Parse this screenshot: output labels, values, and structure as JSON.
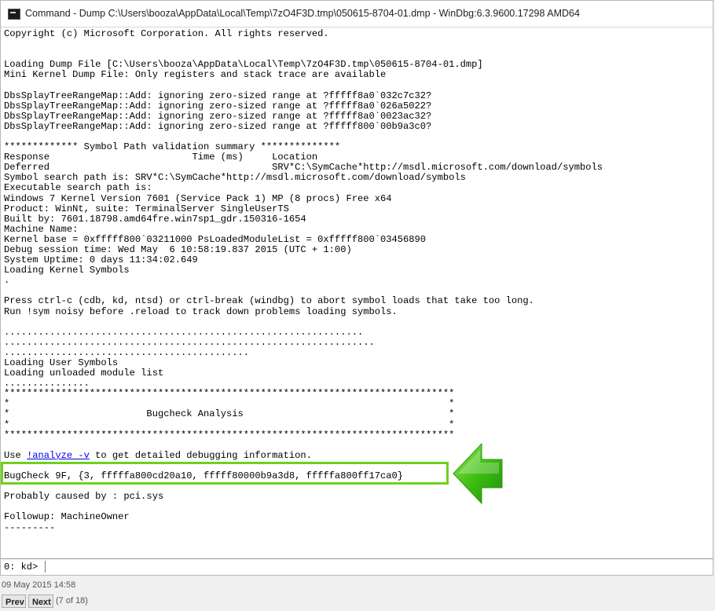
{
  "window": {
    "title": "Command - Dump C:\\Users\\booza\\AppData\\Local\\Temp\\7zO4F3D.tmp\\050615-8704-01.dmp - WinDbg:6.3.9600.17298 AMD64"
  },
  "output": {
    "lines": [
      "Copyright (c) Microsoft Corporation. All rights reserved.",
      "",
      "",
      "Loading Dump File [C:\\Users\\booza\\AppData\\Local\\Temp\\7zO4F3D.tmp\\050615-8704-01.dmp]",
      "Mini Kernel Dump File: Only registers and stack trace are available",
      "",
      "DbsSplayTreeRangeMap::Add: ignoring zero-sized range at ?fffff8a0`032c7c32?",
      "DbsSplayTreeRangeMap::Add: ignoring zero-sized range at ?fffff8a0`026a5022?",
      "DbsSplayTreeRangeMap::Add: ignoring zero-sized range at ?fffff8a0`0023ac32?",
      "DbsSplayTreeRangeMap::Add: ignoring zero-sized range at ?fffff800`00b9a3c0?",
      "",
      "************* Symbol Path validation summary **************",
      "Response                         Time (ms)     Location",
      "Deferred                                       SRV*C:\\SymCache*http://msdl.microsoft.com/download/symbols",
      "Symbol search path is: SRV*C:\\SymCache*http://msdl.microsoft.com/download/symbols",
      "Executable search path is:",
      "Windows 7 Kernel Version 7601 (Service Pack 1) MP (8 procs) Free x64",
      "Product: WinNt, suite: TerminalServer SingleUserTS",
      "Built by: 7601.18798.amd64fre.win7sp1_gdr.150316-1654",
      "Machine Name:",
      "Kernel base = 0xfffff800`03211000 PsLoadedModuleList = 0xfffff800`03456890",
      "Debug session time: Wed May  6 10:58:19.837 2015 (UTC + 1:00)",
      "System Uptime: 0 days 11:34:02.649",
      "Loading Kernel Symbols",
      ".",
      "",
      "Press ctrl-c (cdb, kd, ntsd) or ctrl-break (windbg) to abort symbol loads that take too long.",
      "Run !sym noisy before .reload to track down problems loading symbols.",
      "",
      "...............................................................",
      ".................................................................",
      "...........................................",
      "Loading User Symbols",
      "Loading unloaded module list",
      "...............",
      "*******************************************************************************",
      "*                                                                             *",
      "*                        Bugcheck Analysis                                    *",
      "*                                                                             *",
      "*******************************************************************************",
      "",
      "__ANALYZE__",
      "",
      "BugCheck 9F, {3, fffffa800cd20a10, fffff80000b9a3d8, fffffa800ff17ca0}",
      "",
      "Probably caused by : pci.sys",
      "",
      "Followup: MachineOwner",
      "---------"
    ],
    "analyze_prefix": "Use ",
    "analyze_link": "!analyze -v",
    "analyze_suffix": " to get detailed debugging information."
  },
  "command": {
    "prompt": "0: kd>",
    "value": ""
  },
  "footer": {
    "date": "09 May 2015 14:58",
    "prev_label": "Prev",
    "next_label": "Next",
    "page_count": "(7 of 18)"
  },
  "colors": {
    "highlight": "#6ed21a",
    "arrow": "#3fbf14",
    "link": "#0000ee"
  },
  "icons": {
    "app": "windbg-app-icon",
    "pointer": "green-arrow-icon"
  }
}
